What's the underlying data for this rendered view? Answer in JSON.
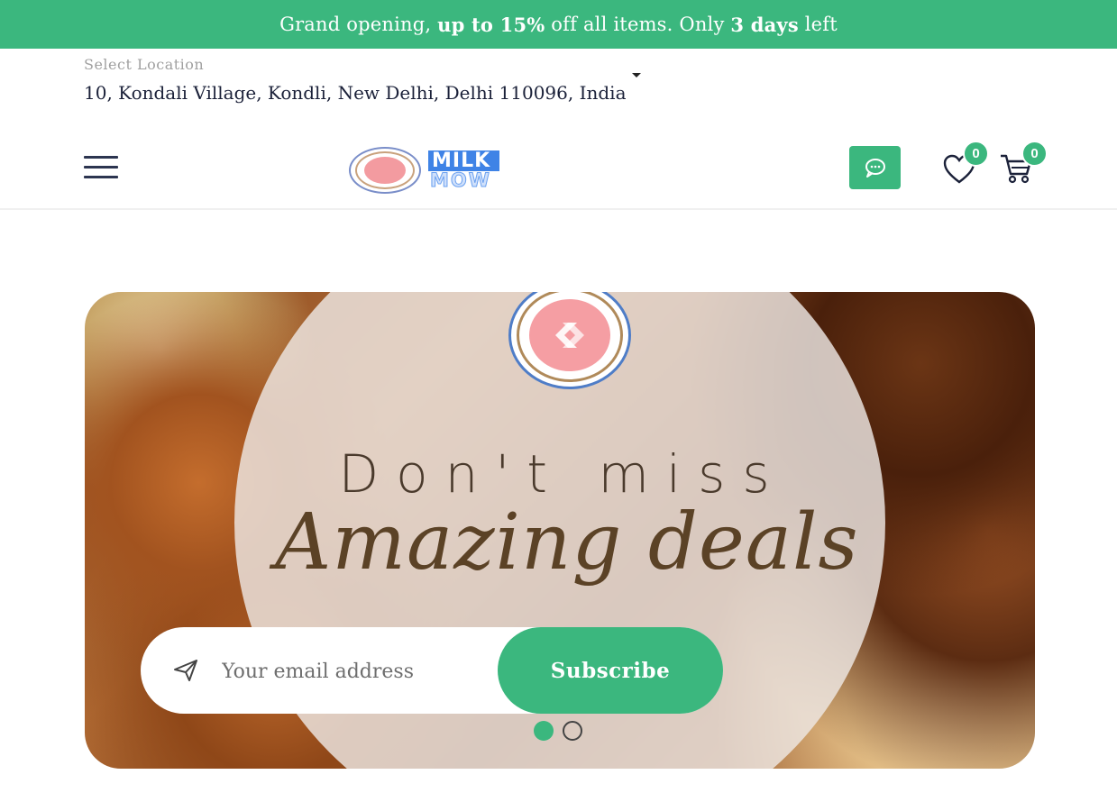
{
  "promo": {
    "part1": "Grand opening, ",
    "part2": "up to 15%",
    "part3": " off all items. Only ",
    "part4": "3 days",
    "part5": " left"
  },
  "location": {
    "label": "Select Location",
    "value": "10, Kondali Village, Kondli, New Delhi, Delhi 110096, India"
  },
  "header": {
    "logo_line1": "MILK",
    "logo_line2": "MOW",
    "wishlist_count": "0",
    "cart_count": "0"
  },
  "banner": {
    "headline1": "Don't miss",
    "headline2": "Amazing deals",
    "email_placeholder": "Your email address",
    "subscribe_label": "Subscribe",
    "slide_count": 2,
    "active_slide": 1
  },
  "colors": {
    "accent": "#3bb77e",
    "logo_blue": "#3f83e6",
    "logo_pink": "#f39ba0"
  },
  "icons": [
    "menu-icon",
    "chat-icon",
    "heart-icon",
    "cart-icon",
    "send-icon"
  ]
}
